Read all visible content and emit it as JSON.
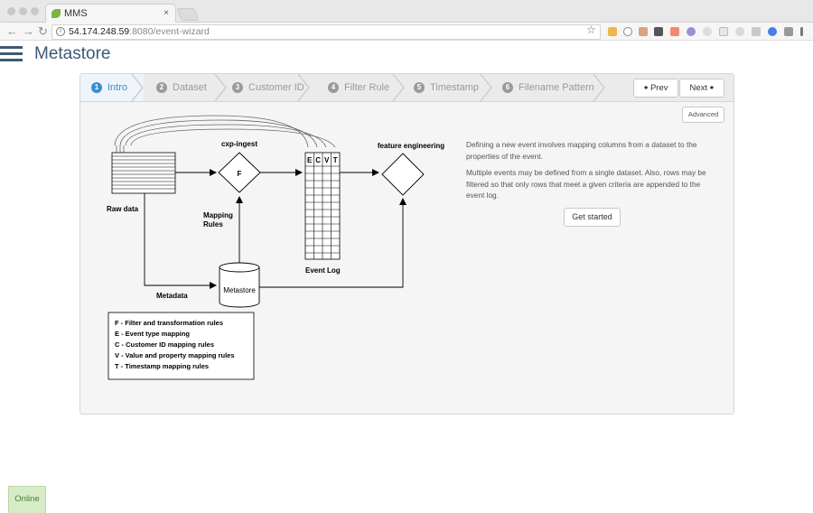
{
  "browser": {
    "tab_title": "MMS",
    "tab_close": "×",
    "url_host": "54.174.248.59",
    "url_path": ":8080/event-wizard"
  },
  "app": {
    "title": "Metastore"
  },
  "wizard": {
    "steps": [
      {
        "num": "1",
        "label": "Intro",
        "active": true
      },
      {
        "num": "2",
        "label": "Dataset",
        "active": false
      },
      {
        "num": "3",
        "label": "Customer ID",
        "active": false
      },
      {
        "num": "4",
        "label": "Filter Rule",
        "active": false
      },
      {
        "num": "5",
        "label": "Timestamp",
        "active": false
      },
      {
        "num": "6",
        "label": "Filename Pattern",
        "active": false
      }
    ],
    "prev_label": "Prev",
    "next_label": "Next",
    "advanced_label": "Advanced",
    "description_1": "Defining a new event involves mapping columns from a dataset to the properties of the event.",
    "description_2": "Multiple events may be defined from a single dataset. Also, rows may be filtered so that only rows that meet a given criteria are appended to the event log.",
    "get_started_label": "Get started"
  },
  "diagram": {
    "raw_data": "Raw data",
    "cxp_ingest": "cxp-ingest",
    "f_node": "F",
    "mapping_rules_1": "Mapping",
    "mapping_rules_2": "Rules",
    "event_log": "Event Log",
    "log_cols": [
      "E",
      "C",
      "V",
      "T"
    ],
    "feature_engineering": "feature engineering",
    "metastore": "Metastore",
    "metadata": "Metadata",
    "legend": [
      "F  -  Filter and transformation rules",
      "E  -  Event type mapping",
      "C  -  Customer ID mapping rules",
      "V  -  Value and property mapping rules",
      "T  -  Timestamp mapping rules"
    ]
  },
  "status": {
    "online": "Online"
  },
  "colors": {
    "accent": "#3a8fd0",
    "brand": "#3d5a73",
    "online_bg": "#d7ecc6"
  }
}
